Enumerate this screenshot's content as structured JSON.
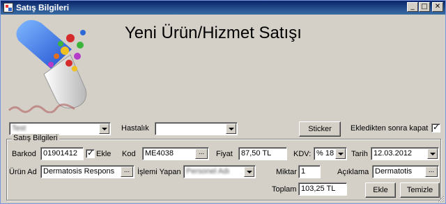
{
  "window": {
    "title": "Satış Bilgileri",
    "minimize": "_",
    "maximize": "□",
    "close": "✕"
  },
  "page": {
    "heading": "Yeni Ürün/Hizmet Satışı"
  },
  "top_row": {
    "customer_value": "Test",
    "hastalik_label": "Hastalık",
    "hastalik_value": "",
    "sticker_label": "Sticker",
    "close_after_add_label": "Ekledikten sonra kapat",
    "close_after_add_checked": true
  },
  "group": {
    "title": "Satış Bilgileri",
    "barkod_label": "Barkod",
    "barkod_value": "01901412",
    "ekle_check_label": "Ekle",
    "kod_label": "Kod",
    "kod_value": "ME4038",
    "fiyat_label": "Fiyat",
    "fiyat_value": "87,50 TL",
    "kdv_label": "KDV:",
    "kdv_value": "% 18",
    "tarih_label": "Tarih",
    "tarih_value": "12.03.2012",
    "urun_ad_label": "Ürün Ad",
    "urun_ad_value": "Dermatosis Respons",
    "islemi_yapan_label": "İşlemi Yapan",
    "islemi_yapan_value": "Personel Adı",
    "miktar_label": "Miktar",
    "miktar_value": "1",
    "aciklama_label": "Açıklama",
    "aciklama_value": "Dermatotis",
    "toplam_label": "Toplam",
    "toplam_value": "103,25 TL",
    "ellipsis": "...",
    "ekle_button": "Ekle",
    "temizle_button": "Temizle"
  },
  "icons": [
    "capsule-logo",
    "signature-image",
    "dropdown-arrow-icon",
    "ellipsis-icon",
    "size-grip-icon"
  ]
}
